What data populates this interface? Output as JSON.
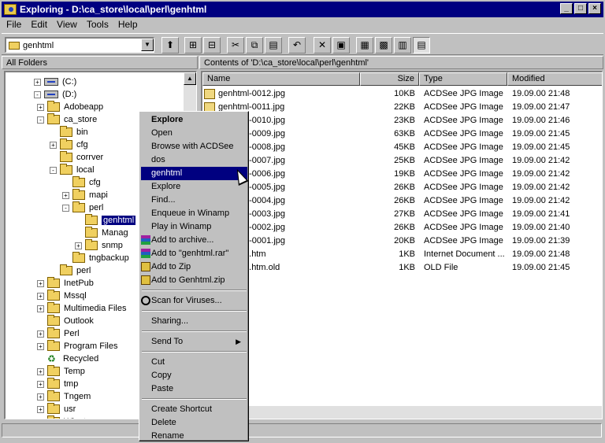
{
  "window": {
    "title": "Exploring - D:\\ca_store\\local\\perl\\genhtml"
  },
  "menu": [
    "File",
    "Edit",
    "View",
    "Tools",
    "Help"
  ],
  "address": {
    "value": "genhtml"
  },
  "panes": {
    "left_header": "All Folders",
    "right_header": "Contents of 'D:\\ca_store\\local\\perl\\genhtml'"
  },
  "tree": [
    {
      "label": "(C:)",
      "kind": "drive",
      "pm": "+"
    },
    {
      "label": "(D:)",
      "kind": "drive",
      "pm": "-"
    },
    {
      "label": "Adobeapp",
      "kind": "folder",
      "pm": "+"
    },
    {
      "label": "ca_store",
      "kind": "folder",
      "pm": "-"
    },
    {
      "label": "bin",
      "kind": "folder",
      "pm": ""
    },
    {
      "label": "cfg",
      "kind": "folder",
      "pm": "+"
    },
    {
      "label": "corrver",
      "kind": "folder",
      "pm": ""
    },
    {
      "label": "local",
      "kind": "folder",
      "pm": "-"
    },
    {
      "label": "cfg",
      "kind": "folder",
      "pm": ""
    },
    {
      "label": "mapi",
      "kind": "folder",
      "pm": "+"
    },
    {
      "label": "perl",
      "kind": "folder",
      "pm": "-"
    },
    {
      "label": "genhtml",
      "kind": "folder",
      "pm": "",
      "selected": true
    },
    {
      "label": "Manag",
      "kind": "folder",
      "pm": ""
    },
    {
      "label": "snmp",
      "kind": "folder",
      "pm": "+"
    },
    {
      "label": "tngbackup",
      "kind": "folder",
      "pm": ""
    },
    {
      "label": "perl",
      "kind": "folder",
      "pm": ""
    },
    {
      "label": "InetPub",
      "kind": "folder",
      "pm": "+"
    },
    {
      "label": "Mssql",
      "kind": "folder",
      "pm": "+"
    },
    {
      "label": "Multimedia Files",
      "kind": "folder",
      "pm": "+"
    },
    {
      "label": "Outlook",
      "kind": "folder",
      "pm": ""
    },
    {
      "label": "Perl",
      "kind": "folder",
      "pm": "+"
    },
    {
      "label": "Program Files",
      "kind": "folder",
      "pm": "+"
    },
    {
      "label": "Recycled",
      "kind": "recycle",
      "pm": ""
    },
    {
      "label": "Temp",
      "kind": "folder",
      "pm": "+"
    },
    {
      "label": "tmp",
      "kind": "folder",
      "pm": "+"
    },
    {
      "label": "Tngem",
      "kind": "folder",
      "pm": "+"
    },
    {
      "label": "usr",
      "kind": "folder",
      "pm": "+"
    },
    {
      "label": "Winnt",
      "kind": "folder",
      "pm": "+"
    }
  ],
  "columns": [
    "Name",
    "Size",
    "Type",
    "Modified"
  ],
  "files": [
    {
      "name": "genhtml-0012.jpg",
      "size": "10KB",
      "type": "ACDSee JPG Image",
      "modified": "19.09.00 21:48"
    },
    {
      "name": "genhtml-0011.jpg",
      "size": "22KB",
      "type": "ACDSee JPG Image",
      "modified": "19.09.00 21:47"
    },
    {
      "name": "genhtml-0010.jpg",
      "size": "23KB",
      "type": "ACDSee JPG Image",
      "modified": "19.09.00 21:46"
    },
    {
      "name": "genhtml-0009.jpg",
      "size": "63KB",
      "type": "ACDSee JPG Image",
      "modified": "19.09.00 21:45"
    },
    {
      "name": "genhtml-0008.jpg",
      "size": "45KB",
      "type": "ACDSee JPG Image",
      "modified": "19.09.00 21:45"
    },
    {
      "name": "genhtml-0007.jpg",
      "size": "25KB",
      "type": "ACDSee JPG Image",
      "modified": "19.09.00 21:42"
    },
    {
      "name": "genhtml-0006.jpg",
      "size": "19KB",
      "type": "ACDSee JPG Image",
      "modified": "19.09.00 21:42"
    },
    {
      "name": "genhtml-0005.jpg",
      "size": "26KB",
      "type": "ACDSee JPG Image",
      "modified": "19.09.00 21:42"
    },
    {
      "name": "genhtml-0004.jpg",
      "size": "26KB",
      "type": "ACDSee JPG Image",
      "modified": "19.09.00 21:42"
    },
    {
      "name": "genhtml-0003.jpg",
      "size": "27KB",
      "type": "ACDSee JPG Image",
      "modified": "19.09.00 21:41"
    },
    {
      "name": "genhtml-0002.jpg",
      "size": "26KB",
      "type": "ACDSee JPG Image",
      "modified": "19.09.00 21:40"
    },
    {
      "name": "genhtml-0001.jpg",
      "size": "20KB",
      "type": "ACDSee JPG Image",
      "modified": "19.09.00 21:39"
    },
    {
      "name": "genhtml.htm",
      "size": "1KB",
      "type": "Internet Document ...",
      "modified": "19.09.00 21:48"
    },
    {
      "name": "genhtml.htm.old",
      "size": "1KB",
      "type": "OLD File",
      "modified": "19.09.00 21:45"
    }
  ],
  "context_menu": {
    "items": [
      {
        "label": "Explore",
        "bold": true
      },
      {
        "label": "Open"
      },
      {
        "label": "Browse with ACDSee"
      },
      {
        "label": "dos"
      },
      {
        "label": "genhtml",
        "highlighted": true
      },
      {
        "label": "Explore"
      },
      {
        "label": "Find..."
      },
      {
        "label": "Enqueue in Winamp"
      },
      {
        "label": "Play in Winamp"
      },
      {
        "label": "Add to archive...",
        "icon": "winrar-icon"
      },
      {
        "label": "Add to \"genhtml.rar\"",
        "icon": "winrar-icon"
      },
      {
        "label": "Add to Zip",
        "icon": "winzip-icon"
      },
      {
        "label": "Add to Genhtml.zip",
        "icon": "winzip-icon"
      },
      {
        "sep": true
      },
      {
        "label": "Scan for Viruses...",
        "icon": "virus-scan-icon"
      },
      {
        "sep": true
      },
      {
        "label": "Sharing..."
      },
      {
        "sep": true
      },
      {
        "label": "Send To",
        "submenu": true
      },
      {
        "sep": true
      },
      {
        "label": "Cut"
      },
      {
        "label": "Copy"
      },
      {
        "label": "Paste"
      },
      {
        "sep": true
      },
      {
        "label": "Create Shortcut"
      },
      {
        "label": "Delete"
      },
      {
        "label": "Rename"
      }
    ]
  }
}
